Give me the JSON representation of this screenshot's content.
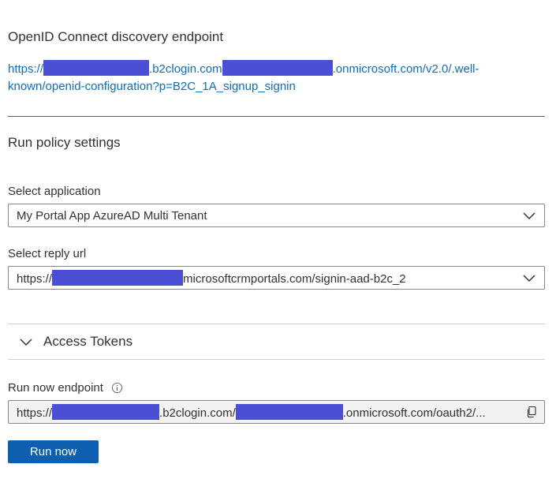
{
  "discovery": {
    "title": "OpenID Connect discovery endpoint",
    "url_prefix": "https://",
    "url_mid": ".b2clogin.com",
    "url_suffix": ".onmicrosoft.com/v2.0/.well-",
    "url_line2": "known/openid-configuration?p=B2C_1A_signup_signin"
  },
  "run_policy": {
    "title": "Run policy settings",
    "select_application": {
      "label": "Select application",
      "value": "My Portal App AzureAD Multi Tenant"
    },
    "select_reply_url": {
      "label": "Select reply url",
      "value_prefix": "https://",
      "value_suffix": "microsoftcrmportals.com/signin-aad-b2c_2"
    }
  },
  "access_tokens": {
    "label": "Access Tokens",
    "expanded": false
  },
  "run_now_endpoint": {
    "label": "Run now endpoint",
    "value_prefix": "https://",
    "value_mid": ".b2clogin.com/",
    "value_suffix": ".onmicrosoft.com/oauth2/..."
  },
  "run_now_button": {
    "label": "Run now"
  },
  "colors": {
    "accent": "#0f5fb0",
    "link": "#0f6cbd",
    "redaction": "#4a4fd6"
  }
}
